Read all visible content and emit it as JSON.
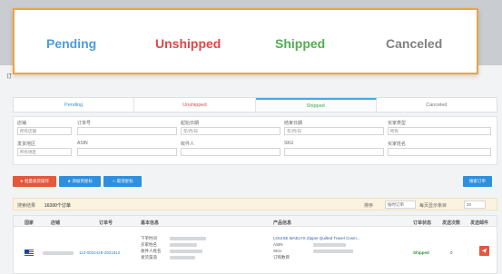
{
  "callout": {
    "pending": "Pending",
    "unshipped": "Unshipped",
    "shipped": "Shipped",
    "canceled": "Canceled"
  },
  "tabs": [
    {
      "label": "Pending"
    },
    {
      "label": "Unshipped"
    },
    {
      "label": "Shipped"
    },
    {
      "label": "Canceled"
    }
  ],
  "filters": {
    "store_label": "店铺",
    "store_value": "所有店铺",
    "order_no_label": "订单号",
    "start_date_label": "起始日期",
    "start_date_placeholder": "年/月/日",
    "end_date_label": "结束日期",
    "end_date_placeholder": "年/月/日",
    "buyer_type_label": "买家类型",
    "buyer_type_value": "所有",
    "ship_region_label": "发货地区",
    "ship_region_value": "所有地区",
    "asin_label": "ASIN",
    "recipient_label": "收件人",
    "sku_label": "SKU",
    "buyer_name_label": "买家姓名"
  },
  "buttons": {
    "batch_ship": "批量发货操作",
    "add_tag": "添加到星标",
    "remove_tag": "取消星标",
    "search": "搜索订单"
  },
  "result_bar": {
    "found_label": "搜索结果",
    "count": "16300个订单",
    "sort_label": "排序",
    "sort_value": "按时订单",
    "per_page_label": "每页显示条目",
    "per_page_value": "20"
  },
  "table": {
    "headers": [
      "国家",
      "店铺",
      "订单号",
      "基本信息",
      "产品信息",
      "订单状态",
      "发送次数",
      "发送邮件"
    ],
    "row": {
      "order_no": "113-0022428-2921812",
      "info_labels": [
        "下单时间",
        "买家姓名",
        "收件人姓名",
        "发货渠道"
      ],
      "product_title": "LOUISE MAELYS Zipper Quilted Travel Cosm...",
      "product_labels": [
        "ASIN",
        "SKU",
        "订购数目"
      ],
      "status": "Shipped",
      "send_count": "0"
    }
  },
  "colors": {
    "pending": "#4a9ddf",
    "unshipped": "#e14646",
    "shipped": "#52ad53",
    "canceled": "#808080",
    "callout_border": "#f0a43a",
    "action_red": "#e4573b",
    "action_blue": "#2f8fdc"
  },
  "icons": [
    "us-flag-icon",
    "send-mail-icon",
    "batch-ship-icon",
    "tag-icon",
    "untag-icon"
  ]
}
